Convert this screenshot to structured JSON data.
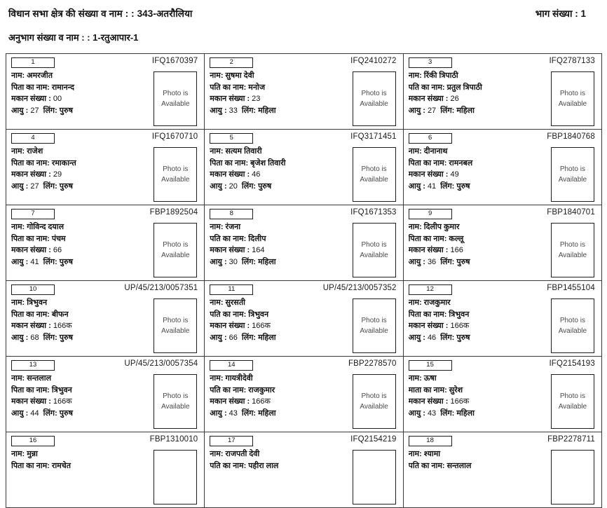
{
  "header": {
    "constituency_line": "विधान सभा क्षेत्र की संख्या व नाम : : 343-अतरौलिया",
    "part_number_line": "भाग संख्या : 1",
    "section_line": "अनुभाग संख्या व नाम :  : 1-रतुआपार-1"
  },
  "photo_placeholder": {
    "line1": "Photo is",
    "line2": "Available"
  },
  "labels": {
    "name": "नाम:",
    "father": "पिता का नाम:",
    "husband": "पति का नाम:",
    "mother": "माता का नाम:",
    "house": "मकान संख्या :",
    "age": "आयु :",
    "gender": "लिंग:"
  },
  "records": [
    {
      "serial": "1",
      "epic_id": "IFQ1670397",
      "name": "अमरजीत",
      "relation_label": "पिता का नाम:",
      "relation_name": "रामानन्द",
      "house_no": "00",
      "age": "27",
      "gender": "पुरुष",
      "photo_status": "available"
    },
    {
      "serial": "2",
      "epic_id": "IFQ2410272",
      "name": "सुषमा देवी",
      "relation_label": "पति का नाम:",
      "relation_name": "मनोज",
      "house_no": "23",
      "age": "33",
      "gender": "महिला",
      "photo_status": "available"
    },
    {
      "serial": "3",
      "epic_id": "IFQ2787133",
      "name": "रिंकी त्रिपाठी",
      "relation_label": "पति का नाम:",
      "relation_name": "प्रतुल त्रिपाठी",
      "house_no": "26",
      "age": "27",
      "gender": "महिला",
      "photo_status": "available"
    },
    {
      "serial": "4",
      "epic_id": "IFQ1670710",
      "name": "राजेश",
      "relation_label": "पिता का नाम:",
      "relation_name": "रमाकान्त",
      "house_no": "29",
      "age": "27",
      "gender": "पुरुष",
      "photo_status": "available"
    },
    {
      "serial": "5",
      "epic_id": "IFQ3171451",
      "name": "सत्यम तिवारी",
      "relation_label": "पिता का नाम:",
      "relation_name": "बृजेश तिवारी",
      "house_no": "46",
      "age": "20",
      "gender": "पुरुष",
      "photo_status": "available"
    },
    {
      "serial": "6",
      "epic_id": "FBP1840768",
      "name": "दीनानाथ",
      "relation_label": "पिता का नाम:",
      "relation_name": "रामनबल",
      "house_no": "49",
      "age": "41",
      "gender": "पुरुष",
      "photo_status": "available"
    },
    {
      "serial": "7",
      "epic_id": "FBP1892504",
      "name": "गोविन्द दयाल",
      "relation_label": "पिता का नाम:",
      "relation_name": "पंचम",
      "house_no": "66",
      "age": "41",
      "gender": "पुरुष",
      "photo_status": "available"
    },
    {
      "serial": "8",
      "epic_id": "IFQ1671353",
      "name": "रंजना",
      "relation_label": "पति का नाम:",
      "relation_name": "दिलीप",
      "house_no": "164",
      "age": "30",
      "gender": "महिला",
      "photo_status": "available"
    },
    {
      "serial": "9",
      "epic_id": "FBP1840701",
      "name": "दिलीप कुमार",
      "relation_label": "पिता का नाम:",
      "relation_name": "कल्लू",
      "house_no": "166",
      "age": "36",
      "gender": "पुरुष",
      "photo_status": "available"
    },
    {
      "serial": "10",
      "epic_id": "UP/45/213/0057351",
      "name": "त्रिभुवन",
      "relation_label": "पिता का नाम:",
      "relation_name": "बीफन",
      "house_no": "166क",
      "age": "68",
      "gender": "पुरुष",
      "photo_status": "available"
    },
    {
      "serial": "11",
      "epic_id": "UP/45/213/0057352",
      "name": "सुरसती",
      "relation_label": "पति का नाम:",
      "relation_name": "त्रिभुवन",
      "house_no": "166क",
      "age": "66",
      "gender": "महिला",
      "photo_status": "available"
    },
    {
      "serial": "12",
      "epic_id": "FBP1455104",
      "name": "राजकुमार",
      "relation_label": "पिता का नाम:",
      "relation_name": "त्रिभुवन",
      "house_no": "166क",
      "age": "46",
      "gender": "पुरुष",
      "photo_status": "available"
    },
    {
      "serial": "13",
      "epic_id": "UP/45/213/0057354",
      "name": "सन्तलाल",
      "relation_label": "पिता का नाम:",
      "relation_name": "त्रिभुवन",
      "house_no": "166क",
      "age": "44",
      "gender": "पुरुष",
      "photo_status": "available"
    },
    {
      "serial": "14",
      "epic_id": "FBP2278570",
      "name": "गायत्रीदेवी",
      "relation_label": "पति का नाम:",
      "relation_name": "राजकुमार",
      "house_no": "166क",
      "age": "43",
      "gender": "महिला",
      "photo_status": "available"
    },
    {
      "serial": "15",
      "epic_id": "IFQ2154193",
      "name": "ऊषा",
      "relation_label": "माता का नाम:",
      "relation_name": "सुरेश",
      "house_no": "166क",
      "age": "43",
      "gender": "महिला",
      "photo_status": "available"
    },
    {
      "serial": "16",
      "epic_id": "FBP1310010",
      "name": "मुन्ना",
      "relation_label": "पिता का नाम:",
      "relation_name": "रामचेत",
      "house_no": "",
      "age": "",
      "gender": "",
      "photo_status": "empty"
    },
    {
      "serial": "17",
      "epic_id": "IFQ2154219",
      "name": "राजपती देवी",
      "relation_label": "पति का नाम:",
      "relation_name": "पहीरा लाल",
      "house_no": "",
      "age": "",
      "gender": "",
      "photo_status": "empty"
    },
    {
      "serial": "18",
      "epic_id": "FBP2278711",
      "name": "श्यामा",
      "relation_label": "पति का नाम:",
      "relation_name": "सन्तलाल",
      "house_no": "",
      "age": "",
      "gender": "",
      "photo_status": "empty"
    }
  ]
}
